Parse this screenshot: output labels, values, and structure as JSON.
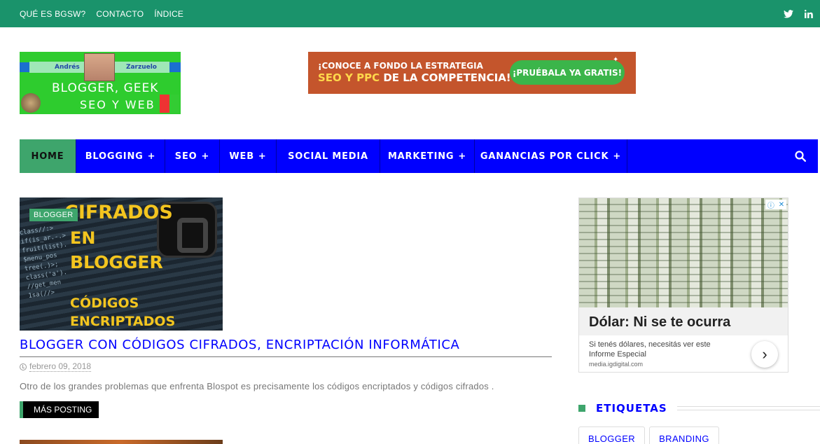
{
  "topbar": {
    "links": [
      "QUÉ ES BGSW?",
      "CONTACTO",
      "ÍNDICE"
    ],
    "social": [
      "twitter-icon",
      "linkedin-icon"
    ],
    "bg_color": "#1a936b"
  },
  "logo": {
    "name_left": "Andrés",
    "name_right": "Zarzuelo",
    "title_line1": "BLOGGER, GEEK",
    "title_line2": "SEO Y WEB"
  },
  "ad_banner": {
    "line1": "¡CONOCE A FONDO LA ESTRATEGIA",
    "line2_highlight": "SEO Y PPC",
    "line2_rest": "DE LA COMPETENCIA!",
    "cta": "¡PRUÉBALA YA GRATIS!"
  },
  "nav": {
    "bg_color": "#0000ff",
    "active_color": "#3ea56c",
    "items": [
      {
        "label": "HOME",
        "has_submenu": false
      },
      {
        "label": "BLOGGING",
        "has_submenu": true
      },
      {
        "label": "SEO",
        "has_submenu": true
      },
      {
        "label": "WEB",
        "has_submenu": true
      },
      {
        "label": "SOCIAL MEDIA",
        "has_submenu": false
      },
      {
        "label": "MARKETING",
        "has_submenu": true
      },
      {
        "label": "GANANCIAS POR CLICK",
        "has_submenu": true
      }
    ],
    "search_icon": "search-icon"
  },
  "post": {
    "category": "BLOGGER",
    "thumb_text": [
      "CIFRADOS",
      "EN",
      "BLOGGER",
      "CÓDIGOS",
      "ENCRIPTADOS"
    ],
    "title": "BLOGGER CON CÓDIGOS CIFRADOS, ENCRIPTACIÓN INFORMÁTICA",
    "date": "febrero 09, 2018",
    "excerpt": "Otro de los grandes problemas que enfrenta Blospot es precisamente los códigos encriptados y códigos cifrados .",
    "more_label": "MÁS POSTING"
  },
  "sidebar_ad": {
    "headline": "Dólar: Ni se te ocurra",
    "description": "Si tenés dólares, necesitás ver este Informe Especial",
    "source": "media.igdigital.com"
  },
  "tags_widget": {
    "title": "ETIQUETAS",
    "tags": [
      "BLOGGER",
      "BRANDING"
    ]
  }
}
